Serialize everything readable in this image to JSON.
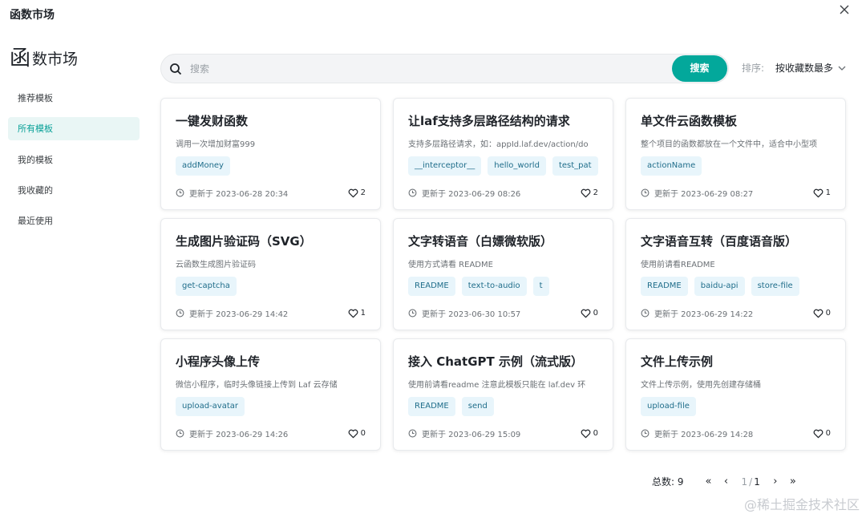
{
  "window": {
    "title": "函数市场"
  },
  "logo": {
    "icon_char": "函",
    "text": "数市场"
  },
  "sidebar": {
    "items": [
      {
        "label": "推荐模板",
        "active": false
      },
      {
        "label": "所有模板",
        "active": true
      },
      {
        "label": "我的模板",
        "active": false
      },
      {
        "label": "我收藏的",
        "active": false
      },
      {
        "label": "最近使用",
        "active": false
      }
    ]
  },
  "search": {
    "placeholder": "搜索",
    "value": "",
    "button_label": "搜索"
  },
  "sort": {
    "label": "排序:",
    "value": "按收藏数最多"
  },
  "cards": [
    {
      "title": "一键发财函数",
      "description": "调用一次增加财富999",
      "tags": [
        "addMoney"
      ],
      "updated": "更新于 2023-06-28 20:34",
      "likes": "2"
    },
    {
      "title": "让laf支持多层路径结构的请求",
      "description": "支持多层路径请求，如：appId.laf.dev/action/do",
      "tags": [
        "__interceptor__",
        "hello_world",
        "test_pat"
      ],
      "updated": "更新于 2023-06-29 08:26",
      "likes": "2"
    },
    {
      "title": "单文件云函数模板",
      "description": "整个项目的函数都放在一个文件中，适合中小型项",
      "tags": [
        "actionName"
      ],
      "updated": "更新于 2023-06-29 08:27",
      "likes": "1"
    },
    {
      "title": "生成图片验证码（SVG）",
      "description": "云函数生成图片验证码",
      "tags": [
        "get-captcha"
      ],
      "updated": "更新于 2023-06-29 14:42",
      "likes": "1"
    },
    {
      "title": "文字转语音（白嫖微软版）",
      "description": "使用方式请看 README",
      "tags": [
        "README",
        "text-to-audio",
        "t"
      ],
      "updated": "更新于 2023-06-30 10:57",
      "likes": "0"
    },
    {
      "title": "文字语音互转（百度语音版）",
      "description": "使用前请看README",
      "tags": [
        "README",
        "baidu-api",
        "store-file"
      ],
      "updated": "更新于 2023-06-29 14:22",
      "likes": "0"
    },
    {
      "title": "小程序头像上传",
      "description": "微信小程序，临时头像链接上传到 Laf 云存储",
      "tags": [
        "upload-avatar"
      ],
      "updated": "更新于 2023-06-29 14:26",
      "likes": "0"
    },
    {
      "title": "接入 ChatGPT 示例（流式版）",
      "description": "使用前请看readme 注意此模板只能在 laf.dev 环",
      "tags": [
        "README",
        "send"
      ],
      "updated": "更新于 2023-06-29 15:09",
      "likes": "0"
    },
    {
      "title": "文件上传示例",
      "description": "文件上传示例，使用先创建存储桶",
      "tags": [
        "upload-file"
      ],
      "updated": "更新于 2023-06-29 14:28",
      "likes": "0"
    }
  ],
  "pagination": {
    "total_label": "总数: 9",
    "first": "«",
    "prev": "‹",
    "current": "1",
    "separator": "/",
    "total_pages": "1",
    "next": "›",
    "last": "»"
  },
  "watermark": "@稀土掘金技术社区",
  "colors": {
    "accent": "#03a89b",
    "active_bg": "#e9f6f5",
    "tag_bg": "#e8f5fb",
    "tag_text": "#1f6d8a"
  }
}
